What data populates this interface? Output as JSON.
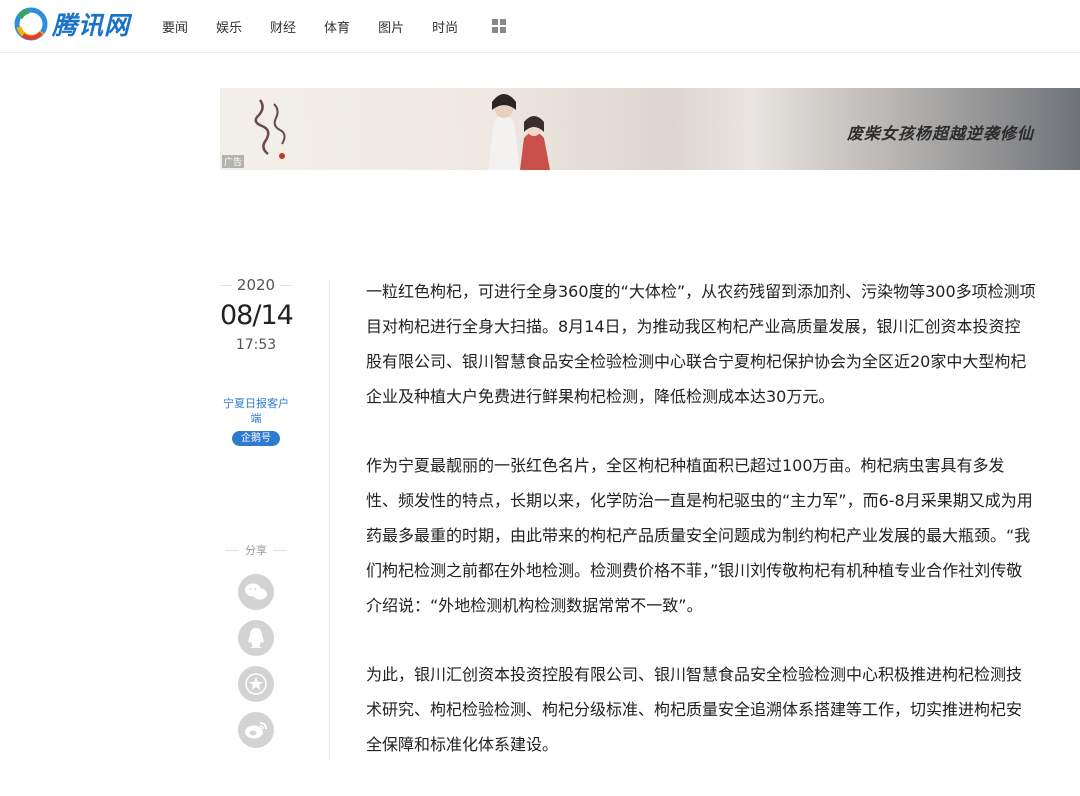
{
  "header": {
    "logo_text": "腾讯网",
    "nav": [
      "要闻",
      "娱乐",
      "财经",
      "体育",
      "图片",
      "时尚"
    ],
    "more_icon": "grid-icon"
  },
  "banner": {
    "tagline": "废柴女孩杨超越逆袭修仙",
    "ad_label": "广告"
  },
  "meta": {
    "year": "2020",
    "date": "08/14",
    "time": "17:53",
    "source": "宁夏日报客户端",
    "badge": "企鹅号"
  },
  "share": {
    "label": "分享",
    "buttons": [
      "wechat-icon",
      "qq-icon",
      "favorite-icon",
      "weibo-icon"
    ]
  },
  "article": {
    "paragraphs": [
      "一粒红色枸杞，可进行全身360度的“大体检”，从农药残留到添加剂、污染物等300多项检测项目对枸杞进行全身大扫描。8月14日，为推动我区枸杞产业高质量发展，银川汇创资本投资控股有限公司、银川智慧食品安全检验检测中心联合宁夏枸杞保护协会为全区近20家中大型枸杞企业及种植大户免费进行鲜果枸杞检测，降低检测成本达30万元。",
      "作为宁夏最靓丽的一张红色名片，全区枸杞种植面积已超过100万亩。枸杞病虫害具有多发性、频发性的特点，长期以来，化学防治一直是枸杞驱虫的“主力军”，而6-8月采果期又成为用药最多最重的时期，由此带来的枸杞产品质量安全问题成为制约枸杞产业发展的最大瓶颈。“我们枸杞检测之前都在外地检测。检测费价格不菲，”银川刘传敬枸杞有机种植专业合作社刘传敬介绍说：“外地检测机构检测数据常常不一致”。",
      "为此，银川汇创资本投资控股有限公司、银川智慧食品安全检验检测中心积极推进枸杞检测技术研究、枸杞检验检测、枸杞分级标准、枸杞质量安全追溯体系搭建等工作，切实推进枸杞安全保障和标准化体系建设。"
    ]
  },
  "colors": {
    "brand_blue": "#1a73c7",
    "link_blue": "#2f7ad0",
    "share_gray": "#d3d3d3"
  }
}
